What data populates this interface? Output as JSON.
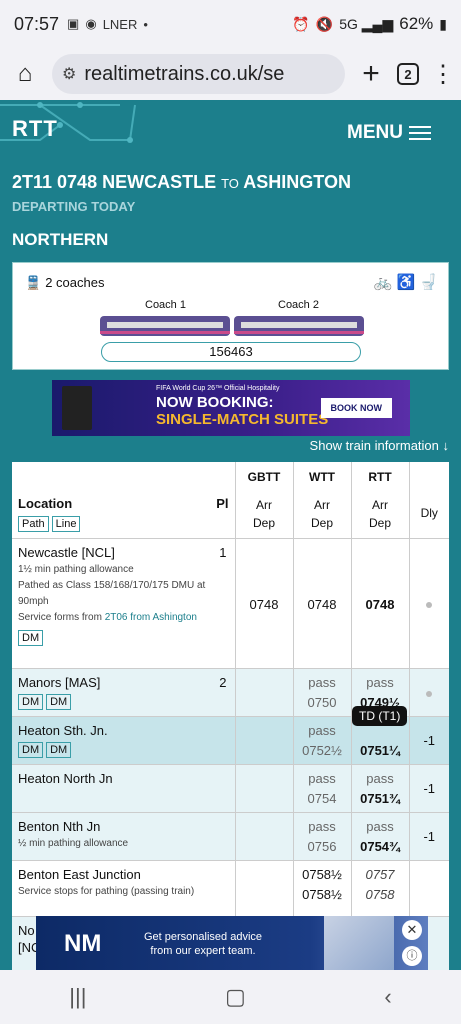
{
  "status": {
    "time": "07:57",
    "battery": "62%",
    "icons": [
      "gallery-icon",
      "chrome-icon",
      "lner-icon",
      "dot-icon"
    ]
  },
  "browser": {
    "url": "realtimetrains.co.uk/se",
    "tab_count": "2"
  },
  "site": {
    "logo": "RTT",
    "menu_label": "MENU"
  },
  "service": {
    "headcode_time": "2T11 0748 NEWCASTLE",
    "to_word": "TO",
    "destination": "ASHINGTON",
    "departing": "DEPARTING TODAY",
    "operator": "NORTHERN"
  },
  "formation": {
    "coach_count": "2 coaches",
    "coaches": [
      "Coach 1",
      "Coach 2"
    ],
    "unit": "156463",
    "facilities": [
      "bicycle-icon",
      "wheelchair-icon",
      "toilet-icon"
    ]
  },
  "ad_top": {
    "small": "FIFA World Cup 26™ Official Hospitality",
    "line1": "NOW BOOKING:",
    "line2": "SINGLE-MATCH SUITES",
    "button": "BOOK NOW"
  },
  "show_info": "Show train information ↓",
  "table": {
    "headers": {
      "location": "Location",
      "pl": "Pl",
      "path_tag": "Path",
      "line_tag": "Line",
      "gbtt": "GBTT",
      "wtt": "WTT",
      "rtt": "RTT",
      "arr": "Arr",
      "dep": "Dep",
      "dly": "Dly"
    },
    "rows": [
      {
        "name": "Newcastle [NCL]",
        "pl": "1",
        "notes": [
          "1½ min pathing allowance",
          "Pathed as Class 158/168/170/175 DMU at 90mph"
        ],
        "service_forms_prefix": "Service forms from ",
        "service_forms_link": "2T06 from Ashington",
        "tags": [
          "DM"
        ],
        "gbtt": "0748",
        "wtt": "0748",
        "rtt": "0748",
        "dly": "•"
      },
      {
        "name": "Manors [MAS]",
        "pl": "2",
        "tags": [
          "DM",
          "DM"
        ],
        "wtt_arr": "pass",
        "wtt_dep": "0750",
        "rtt_arr": "pass",
        "rtt_dep": "0749½",
        "dly": "•"
      },
      {
        "name": "Heaton Sth. Jn.",
        "tags": [
          "DM",
          "DM"
        ],
        "wtt_arr": "pass",
        "wtt_dep": "0752½",
        "rtt_dep": "0751¼",
        "dly": "-1"
      },
      {
        "name": "Heaton North Jn",
        "wtt_arr": "pass",
        "wtt_dep": "0754",
        "rtt_arr": "pass",
        "rtt_dep": "0751¾",
        "dly": "-1"
      },
      {
        "name": "Benton Nth Jn",
        "note": "½ min pathing allowance",
        "wtt_arr": "pass",
        "wtt_dep": "0756",
        "rtt_arr": "pass",
        "rtt_dep": "0754¾",
        "dly": "-1"
      },
      {
        "name": "Benton East Junction",
        "note": "Service stops for pathing (passing train)",
        "wtt_arr": "0758½",
        "wtt_dep": "0758½",
        "rtt_arr": "0757",
        "rtt_dep": "0758"
      },
      {
        "name": "No",
        "name2": "[NC"
      }
    ]
  },
  "tooltip": "TD (T1)",
  "ad_bottom": {
    "brand": "NM",
    "line1": "Get personalised advice",
    "line2": "from our expert team."
  },
  "nav": {
    "recent": "|||",
    "home": "▢",
    "back": "‹"
  }
}
